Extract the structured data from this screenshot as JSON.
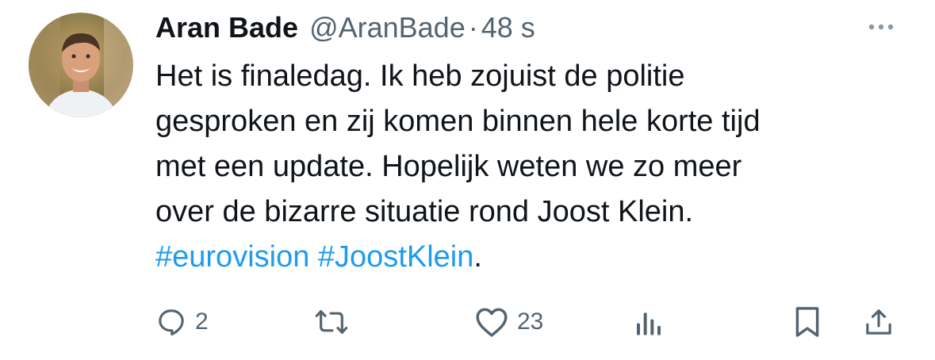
{
  "tweet": {
    "display_name": "Aran Bade",
    "handle": "@AranBade",
    "separator": "·",
    "time": "48 s",
    "text_lines": [
      "Het is finaledag. Ik heb zojuist de politie",
      "gesproken en zij komen binnen hele korte tijd",
      "met een update. Hopelijk weten we zo meer",
      "over de bizarre situatie rond Joost Klein."
    ],
    "hashtags": [
      "#eurovision",
      "#JoostKlein"
    ],
    "hashtag_end": ".",
    "hashtag_color": "#1d9bf0"
  },
  "actions": {
    "replies": {
      "icon": "reply-icon",
      "count": "2"
    },
    "retweets": {
      "icon": "retweet-icon"
    },
    "likes": {
      "icon": "heart-icon",
      "count": "23"
    },
    "views": {
      "icon": "views-icon"
    },
    "bookmark": {
      "icon": "bookmark-icon"
    },
    "share": {
      "icon": "share-icon"
    }
  }
}
